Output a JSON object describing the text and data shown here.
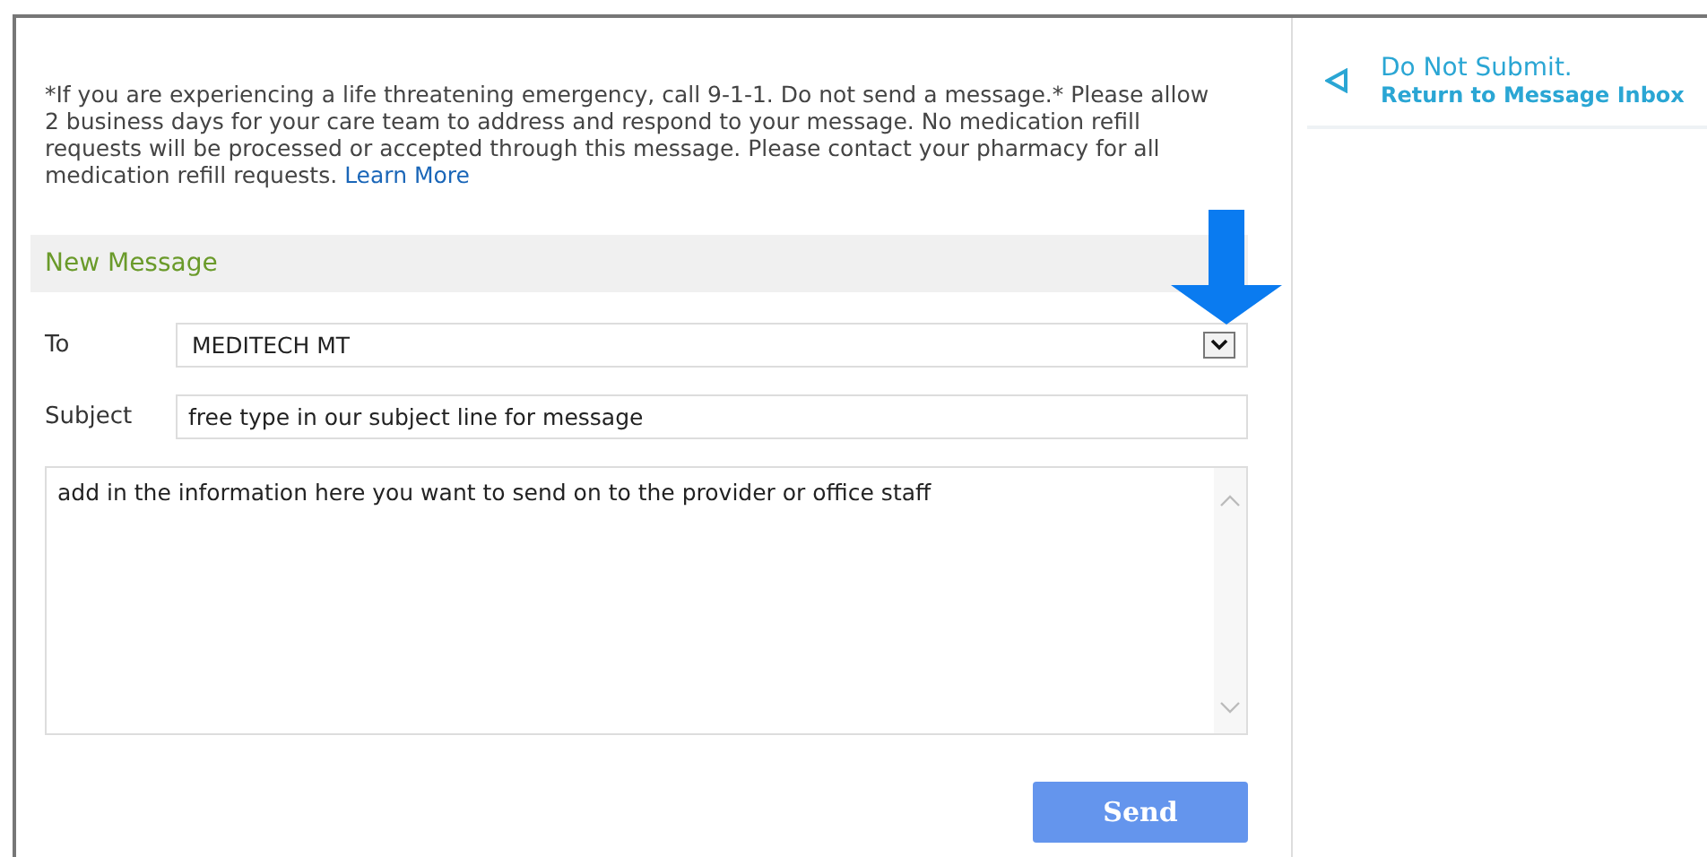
{
  "notice": {
    "text": "*If you are experiencing a life threatening emergency, call 9-1-1. Do not send a message.* Please allow 2 business days for your care team to address and respond to your message. No medication refill requests will be processed or accepted through this message. Please contact your pharmacy for all medication refill requests.",
    "link": "Learn More"
  },
  "section_title": "New Message",
  "to": {
    "label": "To",
    "value": "MEDITECH MT"
  },
  "subject": {
    "label": "Subject",
    "value": "free type in our subject line for message"
  },
  "body": {
    "value": "add in the information here you want to send on to the provider or office staff"
  },
  "send_button": "Send",
  "sidebar": {
    "title": "Do Not Submit.",
    "subtitle": "Return to Message Inbox"
  }
}
